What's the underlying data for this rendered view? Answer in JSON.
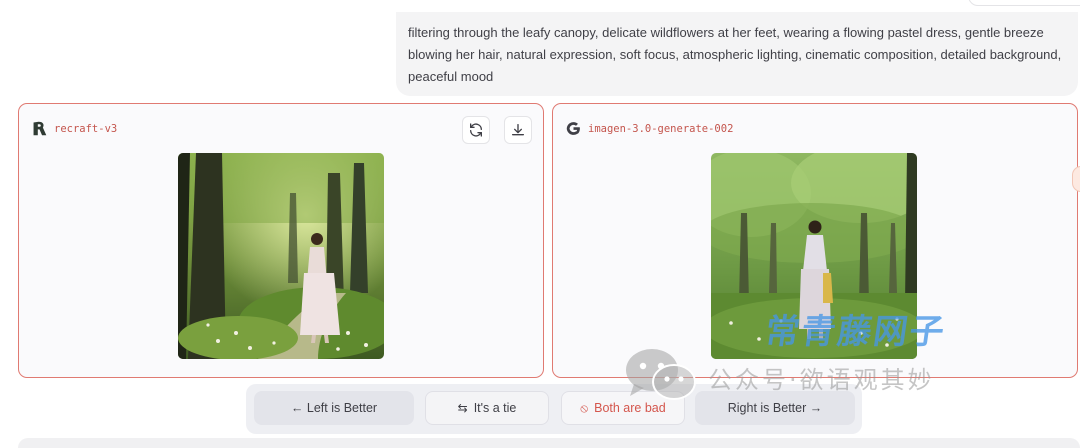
{
  "prompt": {
    "text": "filtering through the leafy canopy, delicate wildflowers at her feet, wearing a flowing pastel dress, gentle breeze blowing her hair, natural expression, soft focus, atmospheric lighting, cinematic composition, detailed background, peaceful mood"
  },
  "panels": {
    "left": {
      "model": "recraft-v3",
      "logo_icon": "recraft-logo-icon",
      "actions": [
        "refresh-icon",
        "download-icon"
      ],
      "image_alt": "Woman in flowing pastel dress walking along a sunlit forest path with wildflowers"
    },
    "right": {
      "model": "imagen-3.0-generate-002",
      "logo_icon": "google-g-icon",
      "image_alt": "Woman in light dress standing in a green orchard meadow"
    }
  },
  "vote": {
    "left_better": "← Left is Better",
    "tie_glyph": "⇆",
    "tie": "It's a tie",
    "bad_glyph": "⦸",
    "bad": "Both are bad",
    "right_better": "Right is Better →"
  },
  "watermark": {
    "title": "常青藤网子",
    "subtitle": "公众号·欲语观其妙"
  },
  "colors": {
    "panel_border": "#e07a72",
    "model_name": "#c4554d",
    "bad_text": "#d4564d"
  }
}
